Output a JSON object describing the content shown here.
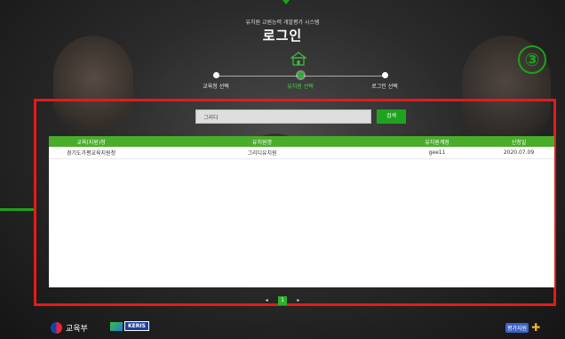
{
  "header": {
    "subtitle": "유치원 교원능력 개발평가 시스템",
    "title": "로그인",
    "step_badge": "③"
  },
  "steps": [
    {
      "label": "교육청 선택",
      "active": false
    },
    {
      "label": "유치원 선택",
      "active": true
    },
    {
      "label": "로그인 선택",
      "active": false
    }
  ],
  "search": {
    "value": "그리디",
    "button_label": "검색"
  },
  "table": {
    "columns": [
      "교육(지원)청",
      "유치원명",
      "유치원계정",
      "신청일"
    ],
    "rows": [
      [
        "경기도가평교육지원청",
        "그리디유치원",
        "gee11",
        "2020.07.09"
      ]
    ]
  },
  "pagination": {
    "prev": "◂",
    "current": "1",
    "next": "▸"
  },
  "footer": {
    "moe_label": "교육부",
    "keris_label": "KERIS",
    "right_logo_label": "평가지원"
  },
  "colors": {
    "accent_green": "#4aad2a",
    "highlight_red": "#e51a1a",
    "badge_green": "#1aa31a"
  }
}
